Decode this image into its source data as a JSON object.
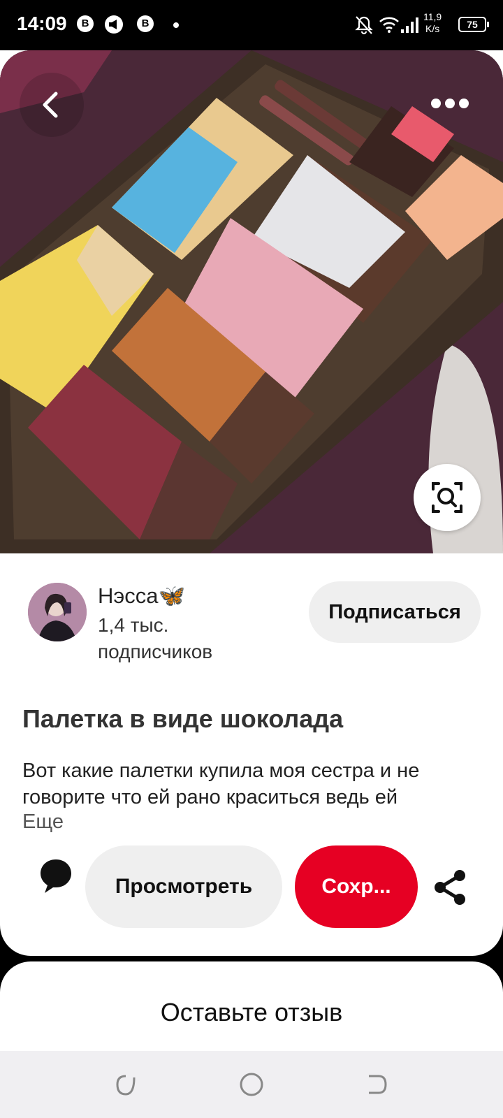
{
  "status_bar": {
    "time": "14:09",
    "app_icon_1": "B",
    "app_icon_3": "B",
    "net_speed_value": "11,9",
    "net_speed_unit": "K/s",
    "battery": "75",
    "icons": [
      "b-circle-icon",
      "megaphone-icon",
      "b-circle-icon",
      "dot-icon",
      "bell-off-icon",
      "wifi-icon",
      "signal-icon",
      "battery-icon"
    ]
  },
  "pin": {
    "creator_name": "Нэсса🦋",
    "followers_line1": "1,4 тыс.",
    "followers_line2": "подписчиков",
    "subscribe_label": "Подписаться",
    "title": "Палетка в виде шоколада",
    "description": "Вот какие палетки купила моя сестра и не говорите что ей рано краситься ведь ей",
    "more_label": "Еще",
    "view_label": "Просмотреть",
    "save_label": "Сохр...",
    "accent_color": "#e60023"
  },
  "comments": {
    "title": "Оставьте отзыв"
  },
  "nav": {
    "icons": [
      "recents-icon",
      "home-icon",
      "back-nav-icon"
    ]
  }
}
